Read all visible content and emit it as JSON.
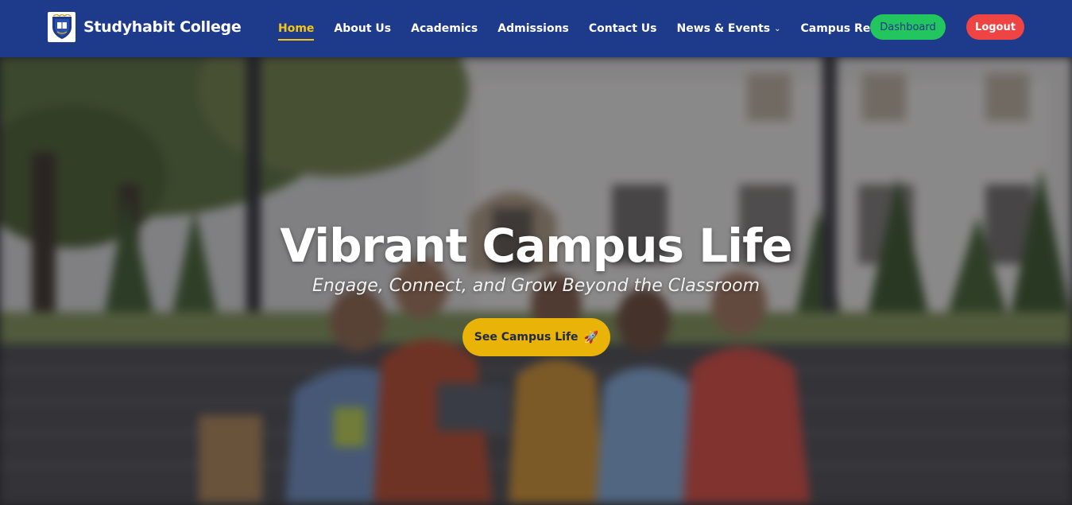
{
  "brand": {
    "name": "Studyhabit College",
    "logo_icon": "college-crest-icon"
  },
  "nav": {
    "items": [
      {
        "label": "Home",
        "active": true,
        "dropdown": false
      },
      {
        "label": "About Us",
        "active": false,
        "dropdown": false
      },
      {
        "label": "Academics",
        "active": false,
        "dropdown": false
      },
      {
        "label": "Admissions",
        "active": false,
        "dropdown": false
      },
      {
        "label": "Contact Us",
        "active": false,
        "dropdown": false
      },
      {
        "label": "News & Events",
        "active": false,
        "dropdown": true
      },
      {
        "label": "Campus Resources",
        "active": false,
        "dropdown": true
      }
    ],
    "dashboard_label": "Dashboard",
    "logout_label": "Logout"
  },
  "hero": {
    "title": "Vibrant Campus Life",
    "subtitle": "Engage, Connect, and Grow Beyond the Classroom",
    "cta_label": "See Campus Life",
    "cta_icon": "rocket-icon"
  },
  "colors": {
    "navbar_bg": "#1e3a8a",
    "active_link": "#f5c518",
    "dashboard_bg": "#22c55e",
    "logout_bg": "#ef4444",
    "cta_bg": "#eab308"
  }
}
